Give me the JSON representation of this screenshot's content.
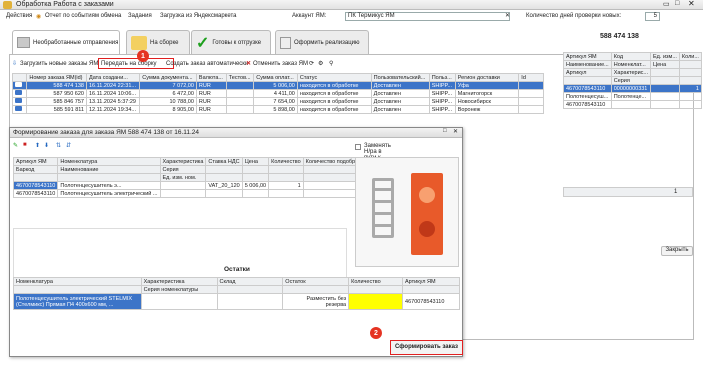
{
  "window": {
    "title": "Обработка  Работа с заказами"
  },
  "toolbar": {
    "actions": "Действия",
    "report": "Отчет по событиям обмена",
    "tasks": "Задания",
    "load_market": "Загрузка из Яндексмаркета",
    "account_label": "Аккаунт ЯМ:",
    "account_value": "ПК Термикус ЯМ",
    "days_label": "Количество дней проверки новых:",
    "days_value": "5"
  },
  "tabs": [
    {
      "label": "Необработанные отправления"
    },
    {
      "label": "На сборке"
    },
    {
      "label": "Готовы к отгрузке"
    },
    {
      "label": "Оформить реализацию"
    }
  ],
  "order_header": "588 474 138",
  "actions_bar": {
    "load_new": "Загрузить новые заказы ЯМ",
    "send_to_assembly": "Передать на сборку",
    "create_auto": "Создать заказ автоматически",
    "cancel_order": "Отменить заказ ЯМ"
  },
  "orders_table": {
    "headers": [
      "",
      "Номер заказа ЯМ(id)",
      "Дата создани...",
      "Сумма документа...",
      "Валюта...",
      "Тестов...",
      "Сумма оплат...",
      "Статус",
      "Пользовательский...",
      "Польз...",
      "Регион доставки",
      "Id"
    ],
    "rows": [
      [
        "",
        "588 474 138",
        "16.11.2024 22:31...",
        "7 072,00",
        "RUR",
        "",
        "5 006,00",
        "находится в обработке",
        "Доставлен",
        "SHIPP...",
        "Уфа",
        ""
      ],
      [
        "",
        "587 950 620",
        "16.11.2024 10:06...",
        "6 472,00",
        "RUR",
        "",
        "4 411,00",
        "находится в обработке",
        "Доставлен",
        "SHIPP...",
        "Магнитогорск",
        ""
      ],
      [
        "",
        "585 846 757",
        "13.11.2024 5:37:29",
        "10 788,00",
        "RUR",
        "",
        "7 654,00",
        "находится в обработке",
        "Доставлен",
        "SHIPP...",
        "Новосибирск",
        ""
      ],
      [
        "",
        "585 591 811",
        "12.11.2024 19:34...",
        "8 905,00",
        "RUR",
        "",
        "5 898,00",
        "находится в обработке",
        "Доставлен",
        "SHIPP...",
        "Воронеж",
        ""
      ]
    ]
  },
  "right_panel": {
    "headers1": [
      "Артикул ЯМ",
      "Код",
      "Ед. изм...",
      "Коли..."
    ],
    "headers2": [
      "Наименование...",
      "Номенклат...",
      "Цена",
      ""
    ],
    "headers3": [
      "Артикул",
      "Характерис...",
      "",
      ""
    ],
    "headers4": [
      "",
      "Серия",
      "",
      ""
    ],
    "rows": [
      [
        "4670078543110",
        "00000000331",
        "",
        "1"
      ],
      [
        "Полотенцесуш...",
        "Полотенце...",
        "",
        ""
      ],
      [
        "4670078543110",
        "",
        "",
        ""
      ]
    ],
    "row_count": "1",
    "close_button": "Закрыть"
  },
  "dialog": {
    "title": "Формирование  заказа для заказа ЯМ 588 474 138 от 16.11.24",
    "replace_checkbox": "Заменять Н/ра в пути к фото",
    "headers1": [
      "Артикул ЯМ",
      "Номенклатура",
      "Характеристика",
      "Ставка НДС",
      "Цена",
      "Количество",
      "Количество подобрано"
    ],
    "headers2": [
      "Баркод",
      "Наименование",
      "Серия",
      "",
      "",
      "",
      ""
    ],
    "headers3": [
      "",
      "",
      "Ед. изм. ном.",
      "",
      "",
      "",
      ""
    ],
    "rows": [
      [
        "4670078543110",
        "Полотенцесушитель э...",
        "",
        "VAT_20_120",
        "5 006,00",
        "1",
        ""
      ],
      [
        "4670078543110",
        "Полотенцесушитель электрический ...",
        "",
        "",
        "",
        "",
        ""
      ]
    ],
    "stock_title": "Остатки",
    "stock_headers": [
      "Номенклатура",
      "Характеристика",
      "Склад",
      "Остаток",
      "Количество",
      "Артикул ЯМ"
    ],
    "stock_headers2": [
      "",
      "Серия номенклатуры",
      "",
      "",
      "",
      ""
    ],
    "stock_row": [
      "Полотенцесушитель электрический STELMIX (Стелмикс) Прямая П4 400х600 мм, ...",
      "",
      "",
      "Разместить без резерва",
      "",
      "4670078543110"
    ],
    "form_button": "Сформировать заказ",
    "badge1": "1",
    "badge2": "2"
  },
  "colors": {
    "accent": "#3c74c8",
    "highlight": "#ffff00",
    "marker": "#e53322"
  }
}
